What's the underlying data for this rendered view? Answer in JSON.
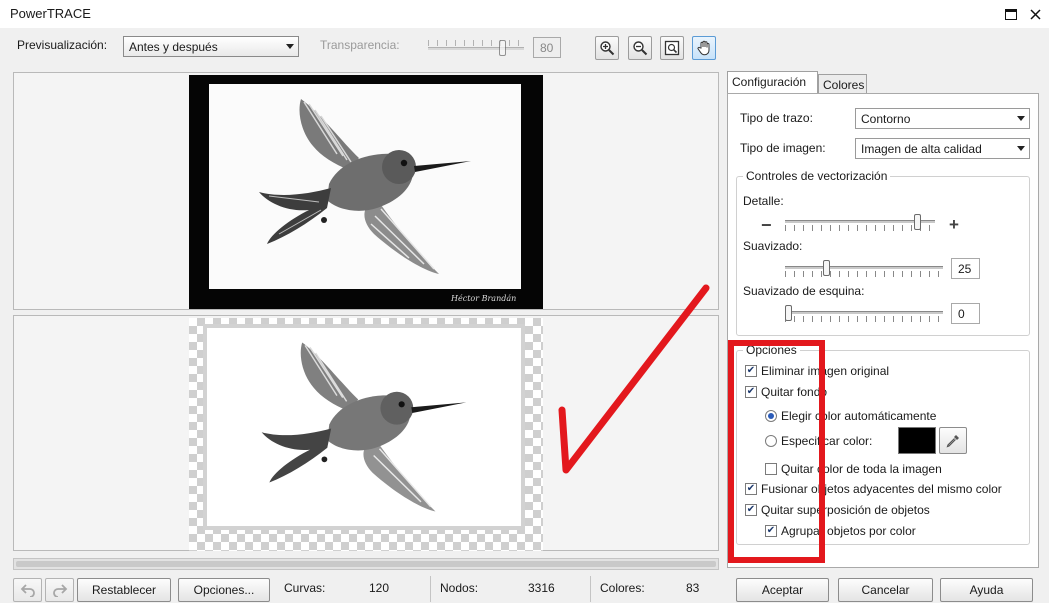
{
  "window": {
    "title": "PowerTRACE"
  },
  "toolbar": {
    "preview_label": "Previsualización:",
    "preview_value": "Antes y después",
    "transparency_label": "Transparencia:",
    "transparency_value": "80"
  },
  "preview": {
    "signature_text": "Héctor Brandán"
  },
  "tabs": [
    {
      "label": "Configuración"
    },
    {
      "label": "Colores"
    }
  ],
  "settings": {
    "trace_type_label": "Tipo de trazo:",
    "trace_type_value": "Contorno",
    "image_type_label": "Tipo de imagen:",
    "image_type_value": "Imagen de alta calidad",
    "controls_title": "Controles de vectorización",
    "detail_label": "Detalle:",
    "detail_minus": "−",
    "detail_plus": "+",
    "smoothing_label": "Suavizado:",
    "smoothing_value": "25",
    "corner_label": "Suavizado de esquina:",
    "corner_value": "0",
    "options_title": "Opciones",
    "remove_original": "Eliminar imagen original",
    "remove_background": "Quitar fondo",
    "auto_color": "Elegir color automáticamente",
    "specify_color": "Especificar color:",
    "remove_color_all": "Quitar color de toda la imagen",
    "merge_adjacent": "Fusionar objetos adyacentes del mismo color",
    "remove_overlap": "Quitar superposición de objetos",
    "group_by_color": "Agrupar objetos por color"
  },
  "levels": {
    "transparency": 0.8,
    "detail": 0.9,
    "smoothing": 0.25,
    "corner": 0
  },
  "status": {
    "reset_label": "Restablecer",
    "options_label": "Opciones...",
    "curves_label": "Curvas:",
    "curves_value": "120",
    "nodes_label": "Nodos:",
    "nodes_value": "3316",
    "colors_label": "Colores:",
    "colors_value": "83"
  },
  "buttons": {
    "accept": "Aceptar",
    "cancel": "Cancelar",
    "help": "Ayuda"
  },
  "colors": {
    "annotation": "#e3181d",
    "specified_color": "#000000"
  }
}
